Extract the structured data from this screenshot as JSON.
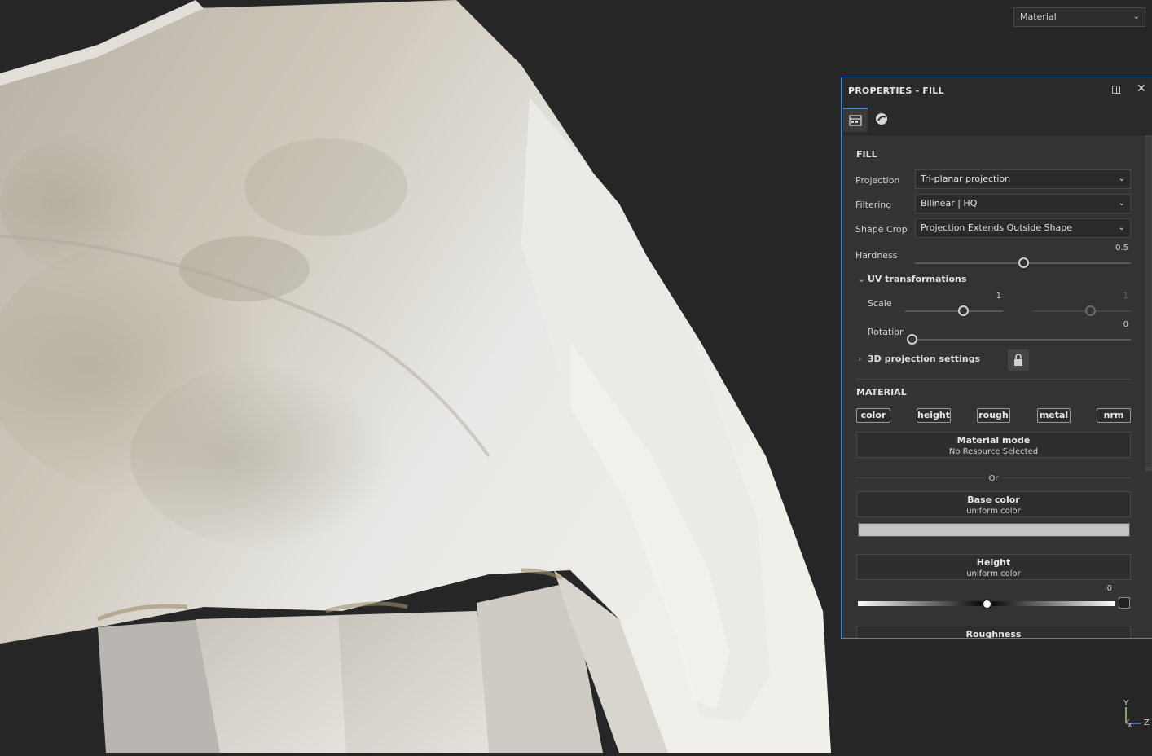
{
  "viewport": {
    "mode_select": "Material"
  },
  "panel": {
    "title": "PROPERTIES - FILL",
    "fill_section": "FILL",
    "projection": {
      "label": "Projection",
      "value": "Tri-planar projection"
    },
    "filtering": {
      "label": "Filtering",
      "value": "Bilinear | HQ"
    },
    "shape_crop": {
      "label": "Shape Crop",
      "value": "Projection Extends Outside Shape"
    },
    "hardness": {
      "label": "Hardness",
      "value": "0.5",
      "fraction": 0.5
    },
    "uv": {
      "title": "UV transformations",
      "scale_label": "Scale",
      "scale_value": "1",
      "scale_value_2": "1",
      "rotation_label": "Rotation",
      "rotation_value": "0"
    },
    "projection_3d": "3D projection settings",
    "material_section": "MATERIAL",
    "channels": [
      "color",
      "height",
      "rough",
      "metal",
      "nrm"
    ],
    "material_mode": {
      "title": "Material mode",
      "subtitle": "No Resource Selected"
    },
    "or_text": "Or",
    "base_color": {
      "title": "Base color",
      "subtitle": "uniform color",
      "swatch": "#c4c4c4"
    },
    "height": {
      "title": "Height",
      "subtitle": "uniform color",
      "value": "0",
      "fraction": 0.5
    },
    "roughness": {
      "title": "Roughness"
    }
  },
  "axis": {
    "y": "Y",
    "z": "Z",
    "x": "X"
  }
}
